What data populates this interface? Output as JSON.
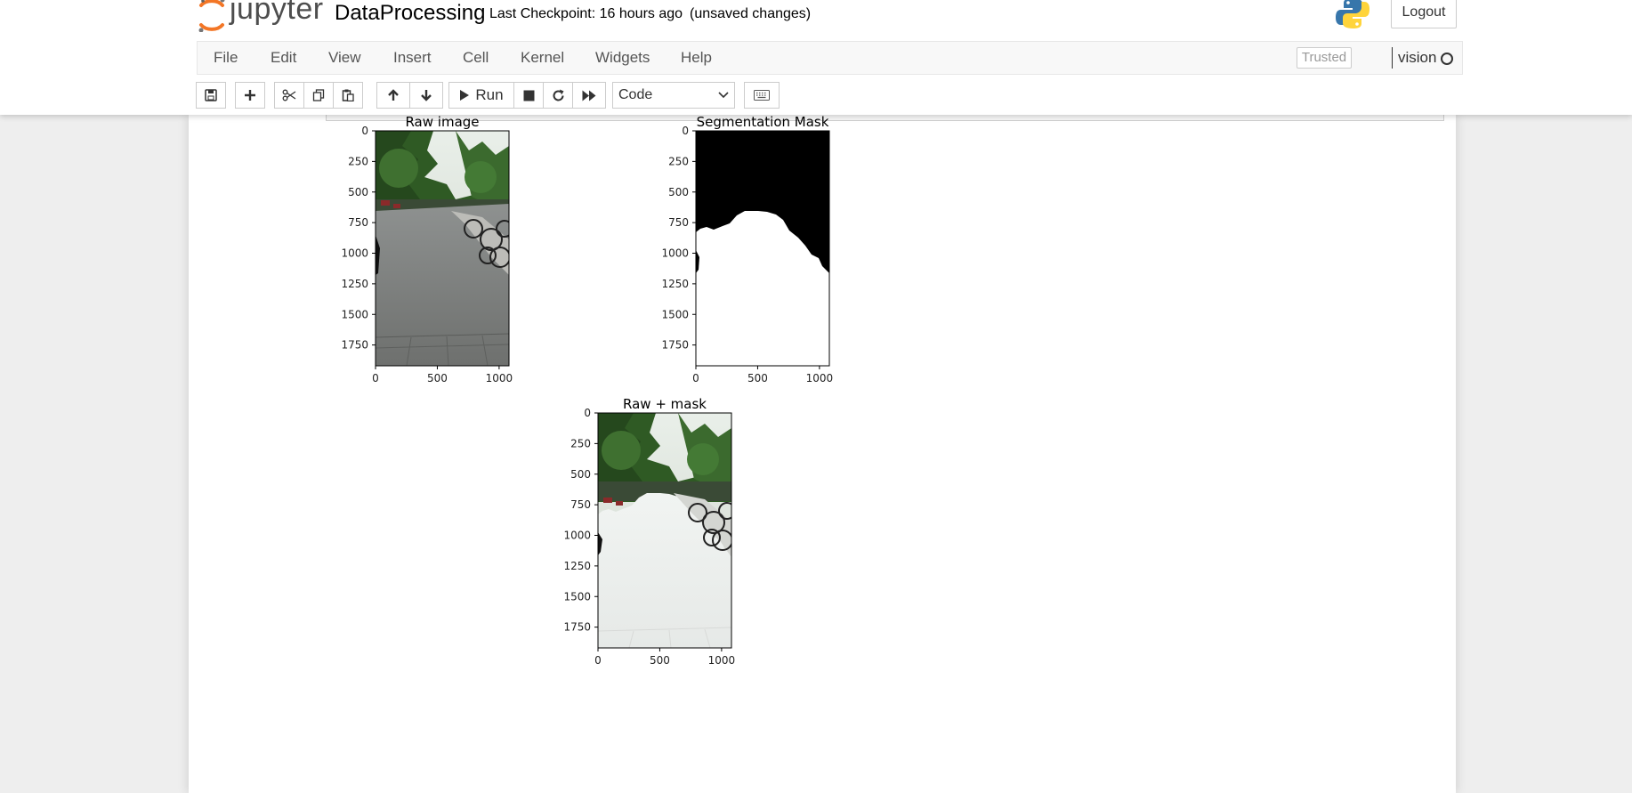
{
  "app": {
    "logo_text": "jupyter",
    "notebook_name": "DataProcessing",
    "checkpoint": "Last Checkpoint: 16 hours ago",
    "unsaved": "(unsaved changes)",
    "logout_label": "Logout"
  },
  "menu": {
    "items": [
      "File",
      "Edit",
      "View",
      "Insert",
      "Cell",
      "Kernel",
      "Widgets",
      "Help"
    ],
    "trusted": "Trusted",
    "kernel_name": "vision"
  },
  "toolbar": {
    "run_label": "Run",
    "cell_type": "Code",
    "icons": [
      "save-icon",
      "plus-icon",
      "cut-icon",
      "copy-icon",
      "paste-icon",
      "arrow-up-icon",
      "arrow-down-icon",
      "play-icon",
      "stop-icon",
      "restart-icon",
      "fast-forward-icon",
      "keyboard-icon"
    ]
  },
  "output": {
    "panels": [
      {
        "title": "Raw image",
        "image": "street photo",
        "yticks": [
          "0",
          "250",
          "500",
          "750",
          "1000",
          "1250",
          "1500",
          "1750"
        ],
        "xticks": [
          "0",
          "500",
          "1000"
        ]
      },
      {
        "title": "Segmentation Mask",
        "image": "binary mask",
        "yticks": [
          "0",
          "250",
          "500",
          "750",
          "1000",
          "1250",
          "1500",
          "1750"
        ],
        "xticks": [
          "0",
          "500",
          "1000"
        ]
      },
      {
        "title": "Raw + mask",
        "image": "street photo with mask overlay",
        "yticks": [
          "0",
          "250",
          "500",
          "750",
          "1000",
          "1250",
          "1500",
          "1750"
        ],
        "xticks": [
          "0",
          "500",
          "1000"
        ]
      }
    ]
  },
  "colors": {
    "jupyter_orange": "#f37626",
    "python_blue": "#3776ab",
    "python_yellow": "#ffd43b",
    "menu_bg": "#f8f8f8",
    "page_bg": "#eeeeee"
  }
}
